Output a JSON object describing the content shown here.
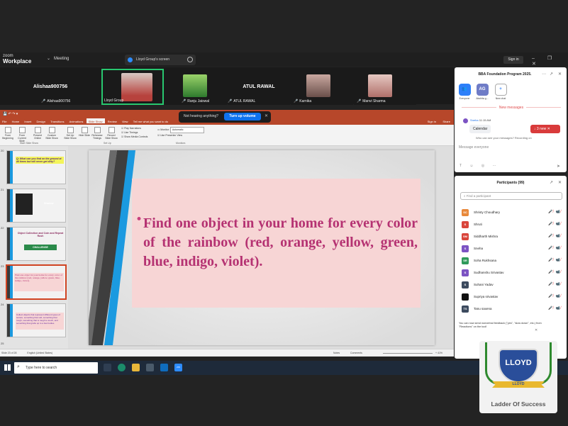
{
  "zoom": {
    "brand_top": "zoom",
    "brand_bottom": "Workplace",
    "meeting_label": "Meeting",
    "share_tab": "Lloyd Group's screen",
    "sign_in": "Sign in",
    "window_controls": "– ❐ ✕"
  },
  "participants_strip": [
    {
      "big": "Alishaa900756",
      "label": "Alishaa900756"
    },
    {
      "big": "",
      "label": "Lloyd Group"
    },
    {
      "big": "",
      "label": "Ranju Jaiswal"
    },
    {
      "big": "ATUL RAWAL",
      "label": "ATUL RAWAL"
    },
    {
      "big": "",
      "label": "Karnika"
    },
    {
      "big": "",
      "label": "Manvi Sharma"
    }
  ],
  "notice": {
    "text": "Not hearing anything?",
    "button": "Turn up volume",
    "close": "✕"
  },
  "ppt": {
    "tabs": [
      "File",
      "Home",
      "Insert",
      "Design",
      "Transitions",
      "Animations",
      "Slide Show",
      "Review",
      "View",
      "Tell me what you want to do"
    ],
    "active_tab": "Slide Show",
    "ribbon": {
      "from_beginning": "From Beginning",
      "from_current": "From Current Slide",
      "present_online": "Present Online",
      "custom_show": "Custom Slide Show",
      "set_up": "Set Up Slide Show",
      "hide": "Hide Slide",
      "rehearse": "Rehearse Timings",
      "record": "Record Slide Show",
      "play_narrations": "Play Narrations",
      "use_timings": "Use Timings",
      "show_media": "Show Media Controls",
      "monitor_label": "Monitor:",
      "monitor_value": "Automatic",
      "presenter_view": "Use Presenter View",
      "group_start": "Start Slide Show",
      "group_setup": "Set Up",
      "group_monitors": "Monitors"
    },
    "signin": "Sign in",
    "share": "Share",
    "thumbs": [
      {
        "num": "20",
        "text": "Q: What can you find on the ground at all times but will never get dirty?"
      },
      {
        "num": "21",
        "text": "Shadow"
      },
      {
        "num": "22",
        "text": "Object Collection and Coin and Repeat Rush",
        "badge": "CHALLENGE"
      },
      {
        "num": "23",
        "text": "Find one object in your home for every color of the rainbow (red, orange, yellow, green, blue, indigo, violet)."
      },
      {
        "num": "24",
        "text": "Collect objects that represent different types of texture, something that soft, something that rough, something that is rough to touch, and something that grabs up to a few bodies."
      },
      {
        "num": "25",
        "text": ""
      }
    ],
    "slide_text": "Find one object in your home for every color of the rainbow (red, orange, yellow, green, blue, indigo, violet).",
    "bullet": "•",
    "status_left": "Slide 23 of 28",
    "status_lang": "English (United States)",
    "status_notes": "Notes",
    "status_comments": "Comments",
    "zoom_pct": "+ 41%"
  },
  "chat": {
    "title": "BBA Foundation Program 2025.",
    "channels": [
      {
        "label": "Everyone",
        "initials": "",
        "color": "#2d7ff9"
      },
      {
        "label": "Akshita g...",
        "initials": "AG",
        "color": "#6f7cc7"
      },
      {
        "label": "New chat",
        "initials": "+",
        "color": "#ffffff"
      }
    ],
    "new_messages": "New messages",
    "sender": "Sneha",
    "time": "11:15 AM",
    "message": "Calendar",
    "new_pill": "↓ 3 new  ✕",
    "who_can_see": "Who can see your messages? Recording on",
    "placeholder": "Message everyone",
    "tools": "T ☺ ◎ ⋯"
  },
  "plist": {
    "title": "Participants (99)",
    "search_placeholder": "Find a participant",
    "people": [
      {
        "initials": "SC",
        "name": "Shristy Choudhary",
        "color": "#e8883a"
      },
      {
        "initials": "S",
        "name": "Shruti",
        "color": "#d9453b"
      },
      {
        "initials": "SM",
        "name": "Siddharth Mishra",
        "color": "#d9453b"
      },
      {
        "initials": "S",
        "name": "Sneha",
        "color": "#7c53c3"
      },
      {
        "initials": "SR",
        "name": "Soha Rukhsana",
        "color": "#2f9a5a"
      },
      {
        "initials": "S",
        "name": "Sudhanshu Srivastav",
        "color": "#7c53c3"
      },
      {
        "initials": "S",
        "name": "Suhani Yadav",
        "color": "#3c4a5e"
      },
      {
        "initials": "",
        "name": "Supriya srivastav",
        "color": "#111111"
      },
      {
        "initials": "TS",
        "name": "Tanu saxena",
        "color": "#3c4a5e"
      }
    ],
    "icons": "🎤̸ 📹̸",
    "tip": "You can now send nonverbal feedback (\"yes\", \"slow down\", etc.) from \"Reactions\" on the tool!",
    "tip_close": "✕"
  },
  "taskbar": {
    "search_placeholder": "Type here to search",
    "zoom_app": "zm"
  },
  "badge": {
    "name": "LLOYD",
    "banner": "LLOYD",
    "tagline": "Ladder Of Success"
  }
}
